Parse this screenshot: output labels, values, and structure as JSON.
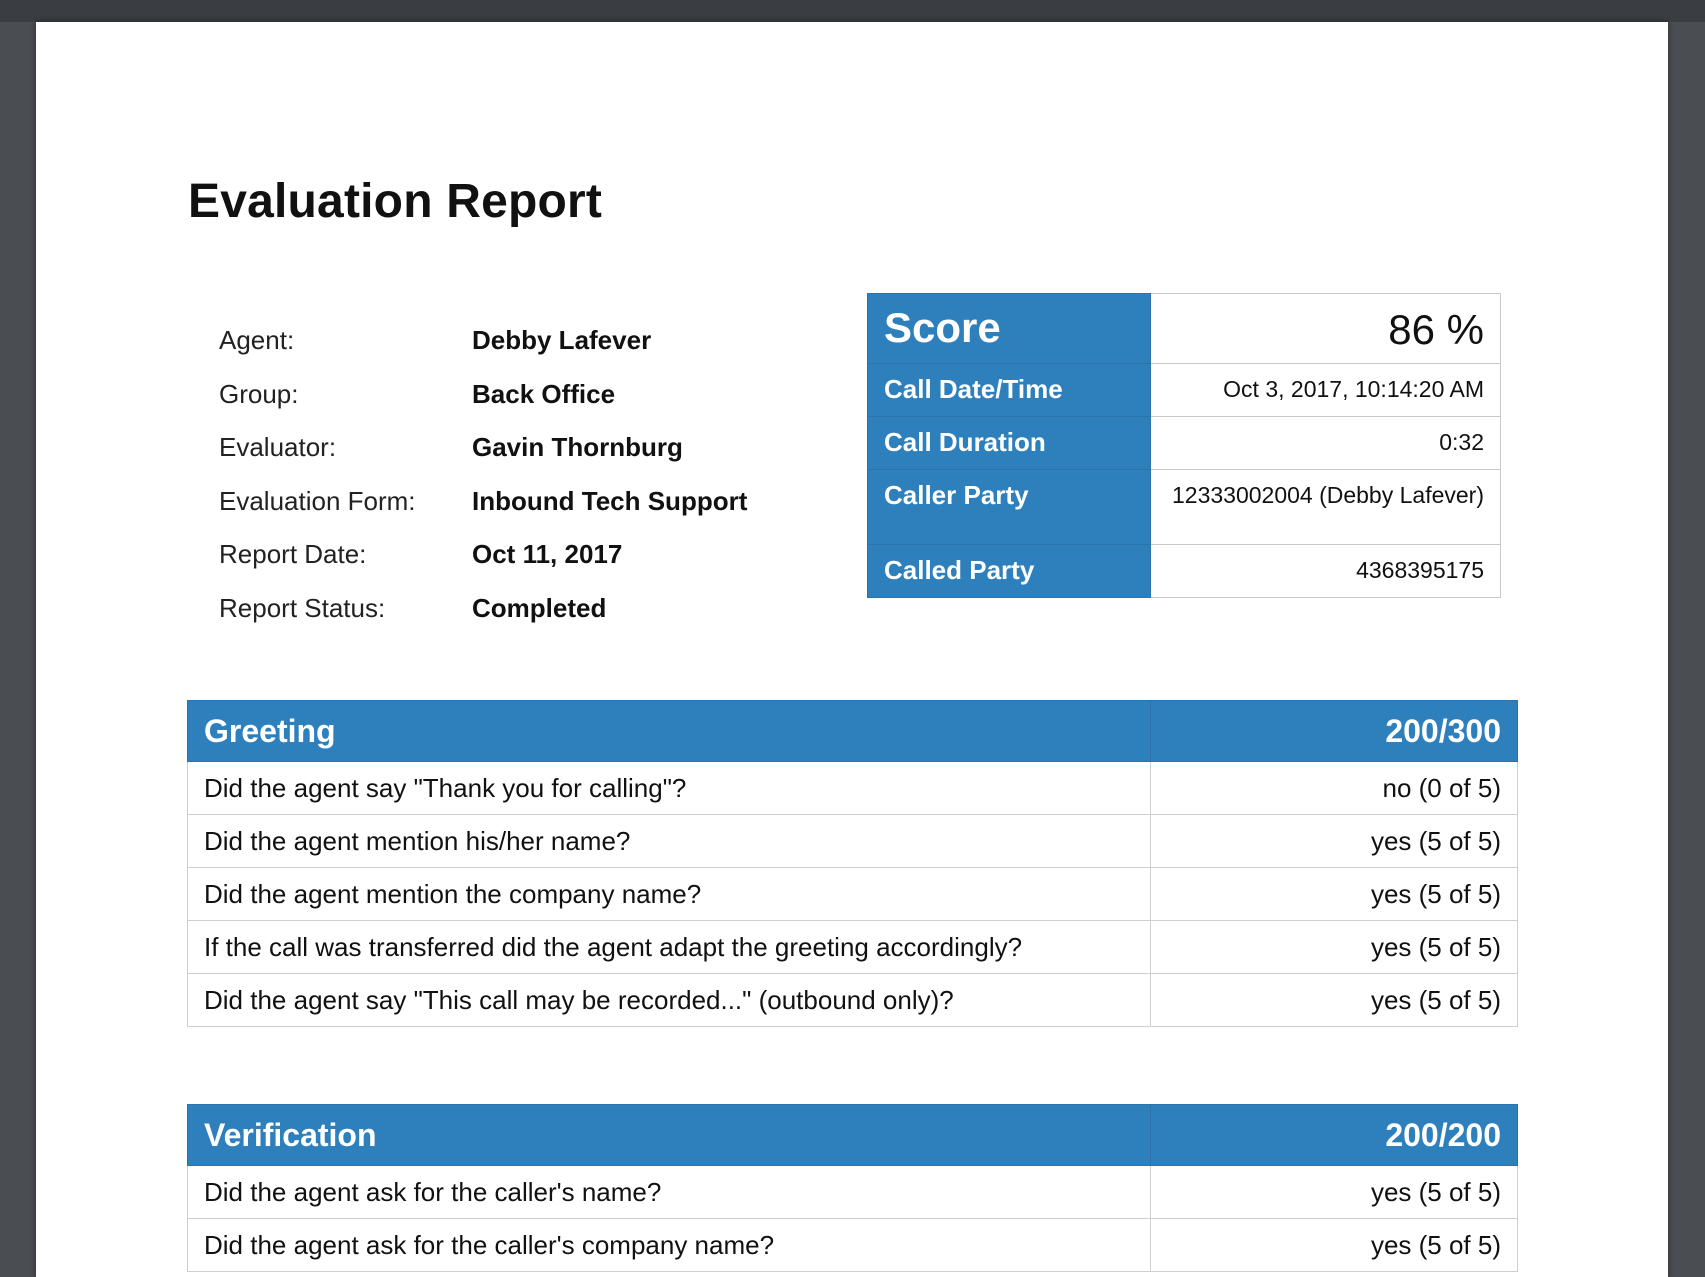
{
  "report": {
    "title": "Evaluation Report",
    "info": [
      {
        "label": "Agent:",
        "value": "Debby Lafever"
      },
      {
        "label": "Group:",
        "value": "Back Office"
      },
      {
        "label": "Evaluator:",
        "value": "Gavin Thornburg"
      },
      {
        "label": "Evaluation Form:",
        "value": "Inbound Tech Support"
      },
      {
        "label": "Report Date:",
        "value": "Oct 11, 2017"
      },
      {
        "label": "Report Status:",
        "value": "Completed"
      }
    ],
    "summary": {
      "score_label": "Score",
      "score_value": "86 %",
      "rows": [
        {
          "label": "Call Date/Time",
          "value": "Oct 3, 2017, 10:14:20 AM"
        },
        {
          "label": "Call Duration",
          "value": "0:32"
        },
        {
          "label": "Caller Party",
          "value": "12333002004 (Debby Lafever)"
        },
        {
          "label": "Called Party",
          "value": "4368395175"
        }
      ]
    },
    "sections": [
      {
        "title": "Greeting",
        "score": "200/300",
        "questions": [
          {
            "q": "Did the agent say \"Thank you for calling\"?",
            "a": "no (0 of 5)"
          },
          {
            "q": "Did the agent mention his/her name?",
            "a": "yes (5 of 5)"
          },
          {
            "q": "Did the agent mention the company name?",
            "a": "yes (5 of 5)"
          },
          {
            "q": "If the call was transferred did the agent adapt the greeting accordingly?",
            "a": "yes (5 of 5)"
          },
          {
            "q": "Did the agent say \"This call may be recorded...\" (outbound only)?",
            "a": "yes (5 of 5)"
          }
        ]
      },
      {
        "title": "Verification",
        "score": "200/200",
        "questions": [
          {
            "q": "Did the agent ask for the caller's name?",
            "a": "yes (5 of 5)"
          },
          {
            "q": "Did the agent ask for the caller's company name?",
            "a": "yes (5 of 5)"
          }
        ]
      }
    ],
    "colors": {
      "header_blue": "#2e80bd",
      "answer_yes": "#2e8b3f",
      "answer_no": "#b8860b"
    }
  }
}
